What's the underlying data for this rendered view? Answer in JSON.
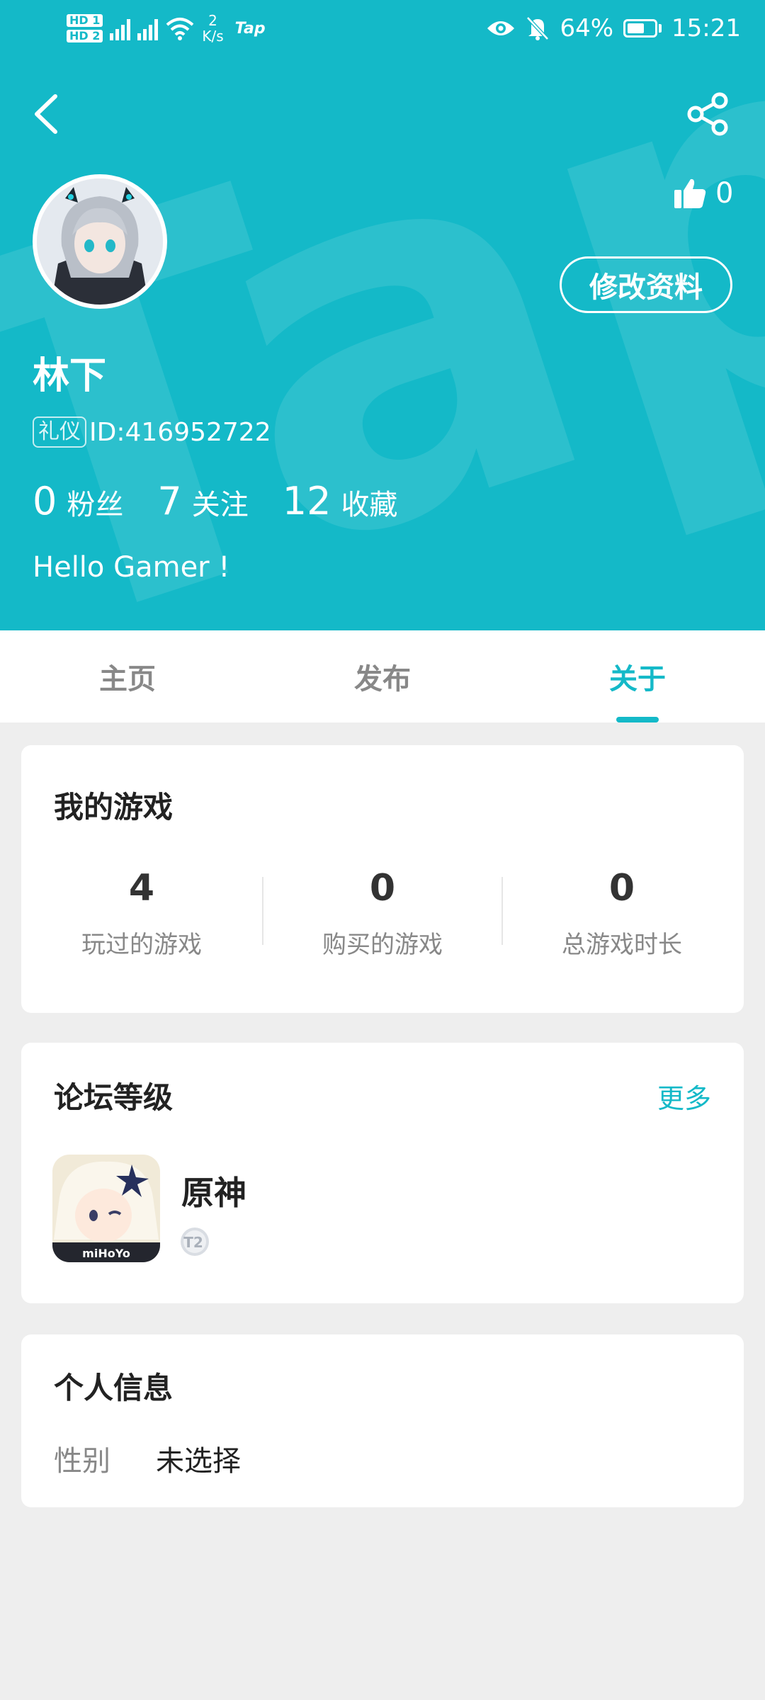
{
  "status_bar": {
    "sim1": "HD 1",
    "sim2": "HD 2",
    "net_speed_value": "2",
    "net_speed_unit": "K/s",
    "app_tag": "Tap",
    "battery": "64%",
    "battery_level": 0.64,
    "time": "15:21"
  },
  "profile": {
    "likes": "0",
    "edit_label": "修改资料",
    "name": "林下",
    "id_tag": "礼仪",
    "id_text": "ID:416952722",
    "stats": [
      {
        "num": "0",
        "label": "粉丝"
      },
      {
        "num": "7",
        "label": "关注"
      },
      {
        "num": "12",
        "label": "收藏"
      }
    ],
    "bio": "Hello Gamer !"
  },
  "tabs": [
    {
      "label": "主页",
      "active": false
    },
    {
      "label": "发布",
      "active": false
    },
    {
      "label": "关于",
      "active": true
    }
  ],
  "my_games": {
    "title": "我的游戏",
    "stats": [
      {
        "value": "4",
        "label": "玩过的游戏"
      },
      {
        "value": "0",
        "label": "购买的游戏"
      },
      {
        "value": "0",
        "label": "总游戏时长"
      }
    ]
  },
  "forum_level": {
    "title": "论坛等级",
    "more_label": "更多",
    "game_name": "原神",
    "icon_brand": "miHoYo",
    "badge": "T2"
  },
  "personal_info": {
    "title": "个人信息",
    "gender_label": "性别",
    "gender_value": "未选择"
  },
  "colors": {
    "accent": "#14b9c8",
    "background": "#eeeeee"
  }
}
